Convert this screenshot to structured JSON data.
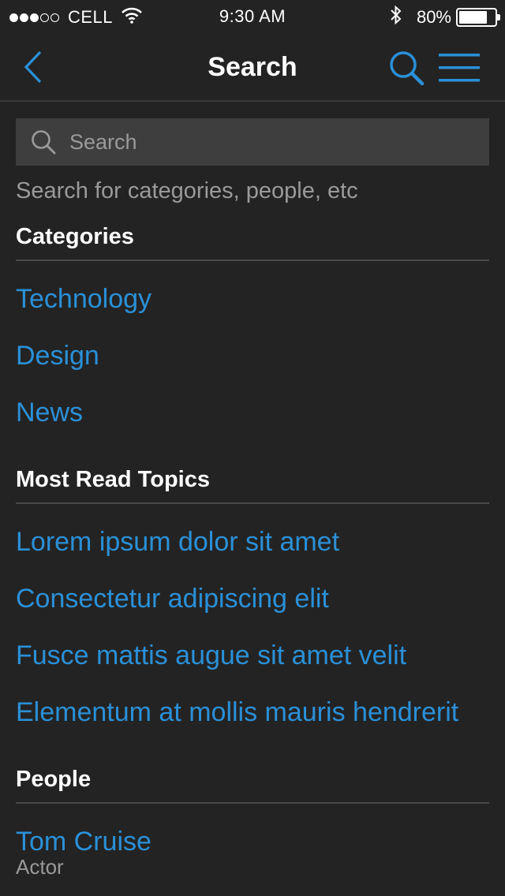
{
  "status_bar": {
    "carrier": "CELL",
    "time": "9:30 AM",
    "battery_percent": "80%",
    "battery_level": 0.8,
    "signal_bars": 3,
    "signal_total": 5
  },
  "nav": {
    "title": "Search",
    "back_icon": "chevron-left-icon",
    "search_icon": "search-icon",
    "menu_icon": "hamburger-menu-icon"
  },
  "search": {
    "placeholder": "Search",
    "value": "",
    "hint": "Search for categories, people, etc"
  },
  "categories": {
    "heading": "Categories",
    "items": [
      "Technology",
      "Design",
      "News"
    ]
  },
  "most_read": {
    "heading": "Most Read Topics",
    "items": [
      "Lorem ipsum dolor sit amet",
      "Consectetur adipiscing elit",
      "Fusce mattis augue sit amet velit",
      "Elementum at mollis mauris hendrerit"
    ]
  },
  "people": {
    "heading": "People",
    "items": [
      {
        "name": "Tom Cruise",
        "role": "Actor"
      }
    ]
  },
  "colors": {
    "background": "#232323",
    "accent": "#2a90d8",
    "search_field": "#3e3e3e",
    "muted_text": "#9a9a9a"
  }
}
